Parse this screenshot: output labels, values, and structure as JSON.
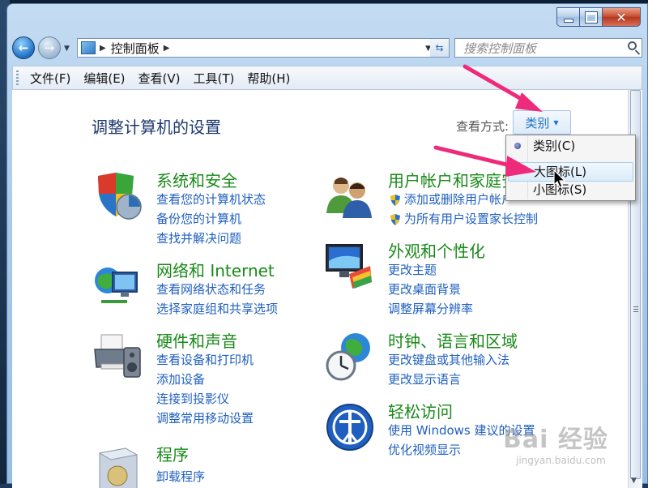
{
  "address": {
    "path": "控制面板"
  },
  "search": {
    "placeholder": "搜索控制面板"
  },
  "menu": [
    "文件(F)",
    "编辑(E)",
    "查看(V)",
    "工具(T)",
    "帮助(H)"
  ],
  "page": {
    "title": "调整计算机的设置",
    "view_label": "查看方式:",
    "view_value": "类别"
  },
  "categories": [
    {
      "title": "系统和安全",
      "links": [
        "查看您的计算机状态",
        "备份您的计算机",
        "查找并解决问题"
      ]
    },
    {
      "title": "网络和 Internet",
      "links": [
        "查看网络状态和任务",
        "选择家庭组和共享选项"
      ]
    },
    {
      "title": "硬件和声音",
      "links": [
        "查看设备和打印机",
        "添加设备",
        "连接到投影仪",
        "调整常用移动设置"
      ]
    },
    {
      "title": "程序",
      "links": [
        "卸载程序"
      ]
    },
    {
      "title": "用户帐户和家庭安",
      "links": [
        "添加或删除用户帐户",
        "为所有用户设置家长控制"
      ]
    },
    {
      "title": "外观和个性化",
      "links": [
        "更改主题",
        "更改桌面背景",
        "调整屏幕分辨率"
      ]
    },
    {
      "title": "时钟、语言和区域",
      "links": [
        "更改键盘或其他输入法",
        "更改显示语言"
      ]
    },
    {
      "title": "轻松访问",
      "links": [
        "使用 Windows 建议的设置",
        "优化视频显示"
      ]
    }
  ],
  "view_menu": [
    "类别(C)",
    "大图标(L)",
    "小图标(S)"
  ],
  "watermark": {
    "brand": "Bai 经验",
    "url": "jingyan.baidu.com"
  },
  "colors": {
    "category_title": "#1a8a1a",
    "link": "#1f5fbf",
    "title": "#1e3a6e",
    "arrow": "#ee2a7b"
  }
}
